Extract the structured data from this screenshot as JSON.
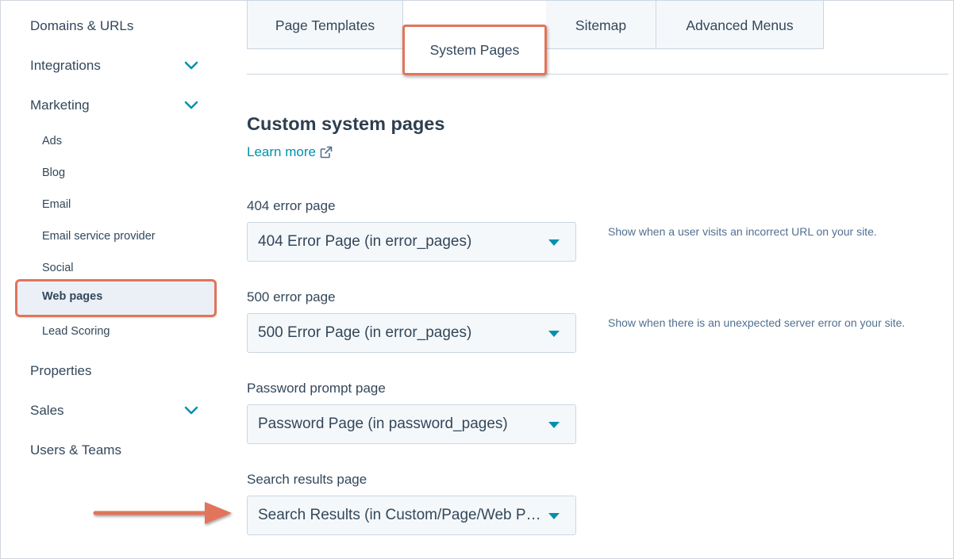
{
  "sidebar": {
    "domains": "Domains & URLs",
    "integrations": "Integrations",
    "marketing": "Marketing",
    "marketing_items": {
      "ads": "Ads",
      "blog": "Blog",
      "email": "Email",
      "esp": "Email service provider",
      "social": "Social",
      "web_pages": "Web pages",
      "lead_scoring": "Lead Scoring"
    },
    "properties": "Properties",
    "sales": "Sales",
    "users": "Users & Teams"
  },
  "tabs": {
    "page_templates": "Page Templates",
    "system_pages": "System Pages",
    "sitemap": "Sitemap",
    "advanced_menus": "Advanced Menus"
  },
  "main": {
    "title": "Custom system pages",
    "learn_more": "Learn more",
    "fields": [
      {
        "label": "404 error page",
        "value": "404 Error Page (in error_pages)",
        "help": "Show when a user visits an incorrect URL on your site."
      },
      {
        "label": "500 error page",
        "value": "500 Error Page (in error_pages)",
        "help": "Show when there is an unexpected server error on your site."
      },
      {
        "label": "Password prompt page",
        "value": "Password Page (in password_pages)"
      },
      {
        "label": "Search results page",
        "value": "Search Results (in Custom/Page/Web Pages)"
      }
    ]
  },
  "colors": {
    "accent": "#0091ae",
    "highlight": "#e0755b",
    "text": "#33475b"
  }
}
